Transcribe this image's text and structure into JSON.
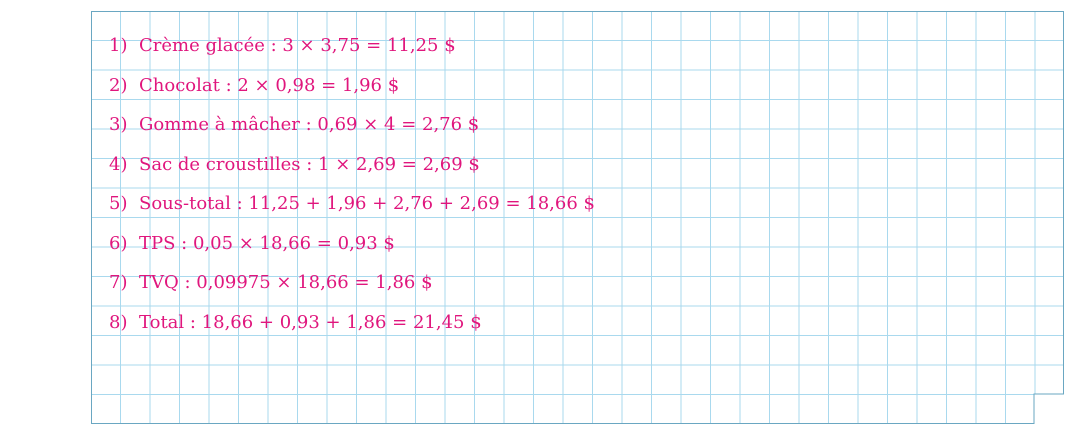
{
  "worksheet": {
    "text_color": "#e0167d",
    "grid_color": "#a9d9ee",
    "border_color": "#6aa7c2",
    "lines": [
      {
        "num": "1)",
        "text": "Crème glacée : 3 × 3,75 = 11,25 $"
      },
      {
        "num": "2)",
        "text": "Chocolat : 2 × 0,98 = 1,96 $"
      },
      {
        "num": "3)",
        "text": "Gomme à mâcher : 0,69 × 4 = 2,76 $"
      },
      {
        "num": "4)",
        "text": "Sac de croustilles : 1 × 2,69 = 2,69 $"
      },
      {
        "num": "5)",
        "text": "Sous-total : 11,25 + 1,96 + 2,76 + 2,69 = 18,66 $"
      },
      {
        "num": "6)",
        "text": "TPS : 0,05 × 18,66 = 0,93 $"
      },
      {
        "num": "7)",
        "text": "TVQ : 0,09975 × 18,66 = 1,86 $"
      },
      {
        "num": "8)",
        "text": "Total : 18,66 + 0,93 + 1,86 = 21,45 $"
      }
    ]
  }
}
